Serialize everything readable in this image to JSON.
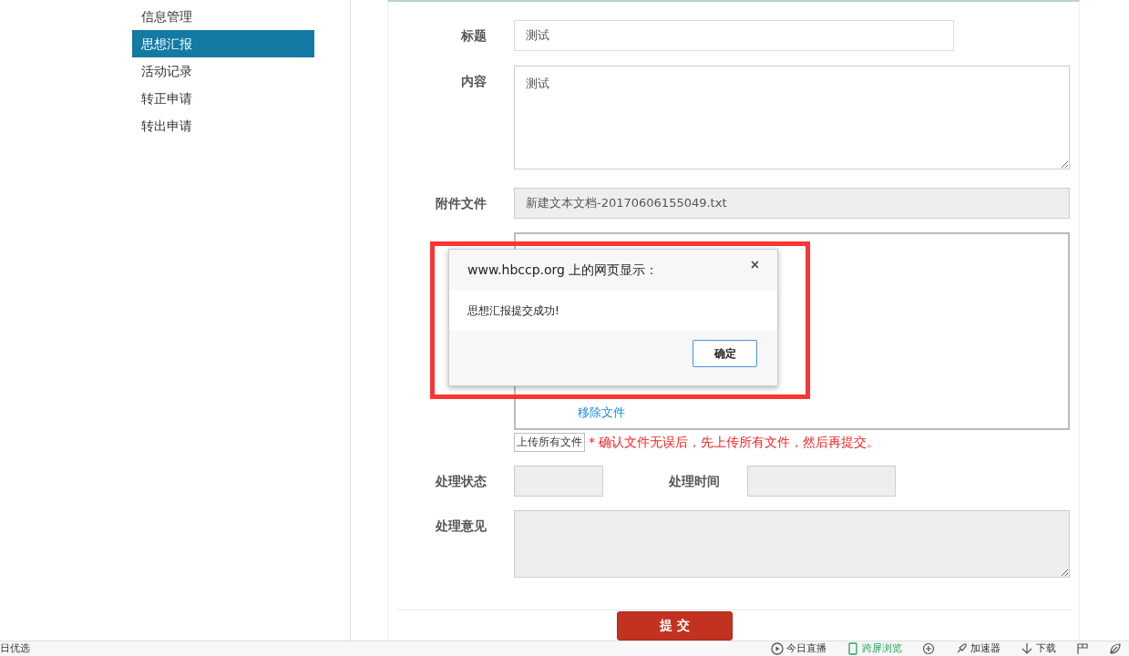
{
  "sidebar": {
    "items": [
      {
        "label": "信息管理",
        "selected": false
      },
      {
        "label": "思想汇报",
        "selected": true
      },
      {
        "label": "活动记录",
        "selected": false
      },
      {
        "label": "转正申请",
        "selected": false
      },
      {
        "label": "转出申请",
        "selected": false
      }
    ]
  },
  "form": {
    "title": {
      "label": "标题",
      "value": "测试"
    },
    "content": {
      "label": "内容",
      "value": "测试"
    },
    "attachment": {
      "label": "附件文件",
      "value": "新建文本文档-20170606155049.txt"
    },
    "files": {
      "remove_link": "移除文件",
      "upload_button": "上传所有文件",
      "note": "* 确认文件无误后，先上传所有文件，然后再提交。"
    },
    "status": {
      "label": "处理状态"
    },
    "time": {
      "label": "处理时间"
    },
    "opinion": {
      "label": "处理意见"
    },
    "submit": "提 交"
  },
  "dialog": {
    "title": "www.hbccp.org 上的网页显示：",
    "message": "思想汇报提交成功!",
    "ok": "确定",
    "close": "×"
  },
  "status_bar": {
    "left": "日优选",
    "items": [
      {
        "label": "今日直播",
        "kind": "play",
        "highlighted": false
      },
      {
        "label": "跨屏浏览",
        "kind": "phone",
        "highlighted": true
      },
      {
        "kind": "badge",
        "highlighted": false
      },
      {
        "label": "加速器",
        "kind": "rocket",
        "highlighted": false
      },
      {
        "label": "下载",
        "kind": "download",
        "highlighted": false
      },
      {
        "kind": "window",
        "highlighted": false
      },
      {
        "kind": "leaf",
        "highlighted": false
      }
    ]
  }
}
